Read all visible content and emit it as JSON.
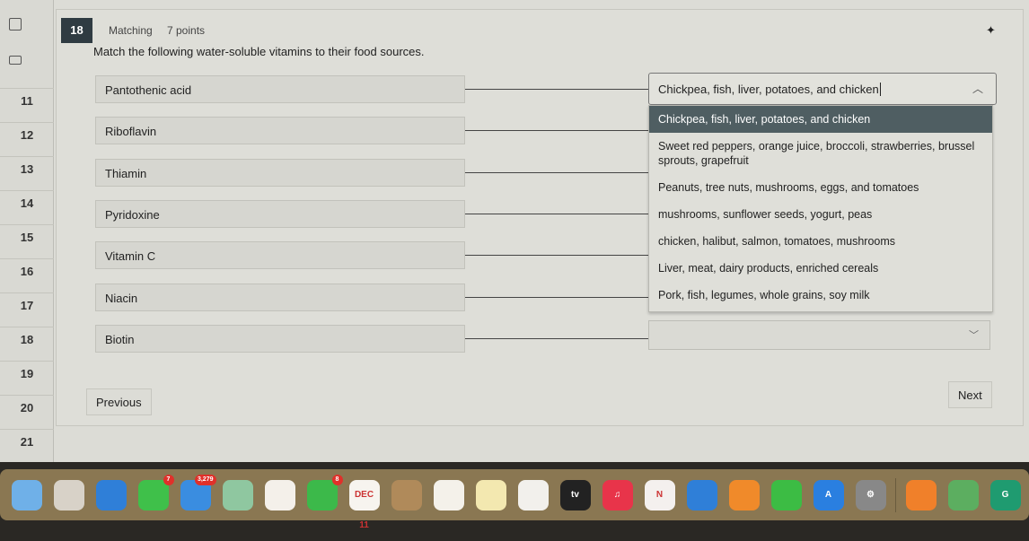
{
  "sidebar": {
    "numbers": [
      "11",
      "12",
      "13",
      "14",
      "15",
      "16",
      "17",
      "18",
      "19",
      "20",
      "21"
    ]
  },
  "question": {
    "number": "18",
    "type": "Matching",
    "points": "7 points",
    "prompt": "Match the following water-soluble vitamins to their food sources."
  },
  "vitamins": [
    "Pantothenic acid",
    "Riboflavin",
    "Thiamin",
    "Pyridoxine",
    "Vitamin C",
    "Niacin",
    "Biotin"
  ],
  "dropdown": {
    "value": "Chickpea, fish, liver, potatoes, and chicken",
    "options": [
      "Chickpea, fish, liver, potatoes, and chicken",
      "Sweet red peppers, orange juice, broccoli, strawberries, brussel sprouts, grapefruit",
      "Peanuts, tree nuts, mushrooms, eggs, and tomatoes",
      "mushrooms, sunflower seeds, yogurt, peas",
      "chicken, halibut, salmon, tomatoes, mushrooms",
      "Liver, meat, dairy products, enriched cereals",
      "Pork, fish, legumes, whole grains, soy milk"
    ]
  },
  "nav": {
    "previous": "Previous",
    "next": "Next"
  },
  "dock": {
    "apps": [
      {
        "name": "finder",
        "color": "#6fb0e8",
        "label": ""
      },
      {
        "name": "launchpad",
        "color": "#d8d2c8",
        "label": ""
      },
      {
        "name": "safari",
        "color": "#2f7fd8",
        "label": ""
      },
      {
        "name": "messages",
        "color": "#3fc04a",
        "label": "",
        "badge": "7"
      },
      {
        "name": "mail",
        "color": "#3a8de0",
        "label": "",
        "badge": "3,279"
      },
      {
        "name": "maps",
        "color": "#8fc7a0",
        "label": ""
      },
      {
        "name": "photos",
        "color": "#f4f0ea",
        "label": ""
      },
      {
        "name": "facetime",
        "color": "#3cb94a",
        "label": "",
        "badge": "8"
      },
      {
        "name": "calendar",
        "color": "#f7f4ef",
        "label": "DEC 11"
      },
      {
        "name": "contacts",
        "color": "#b08a5a",
        "label": ""
      },
      {
        "name": "reminders",
        "color": "#f4f1ea",
        "label": ""
      },
      {
        "name": "notes",
        "color": "#f3e8b0",
        "label": ""
      },
      {
        "name": "freeform",
        "color": "#f2f0ec",
        "label": ""
      },
      {
        "name": "tv",
        "color": "#222",
        "label": "tv"
      },
      {
        "name": "music",
        "color": "#e8344a",
        "label": "♫"
      },
      {
        "name": "news",
        "color": "#f4f0ee",
        "label": "N"
      },
      {
        "name": "keynote",
        "color": "#2f7fd8",
        "label": ""
      },
      {
        "name": "pages",
        "color": "#f08a2a",
        "label": ""
      },
      {
        "name": "numbers",
        "color": "#3cbc44",
        "label": ""
      },
      {
        "name": "app-store",
        "color": "#2a7fe0",
        "label": "A"
      },
      {
        "name": "system-settings",
        "color": "#888",
        "label": "⚙"
      },
      {
        "name": "books",
        "color": "#f0802a",
        "label": ""
      },
      {
        "name": "find-my",
        "color": "#5cae60",
        "label": ""
      },
      {
        "name": "grammarly",
        "color": "#1f9b70",
        "label": "G"
      },
      {
        "name": "trash",
        "color": "#cfcfcf",
        "label": ""
      }
    ]
  }
}
